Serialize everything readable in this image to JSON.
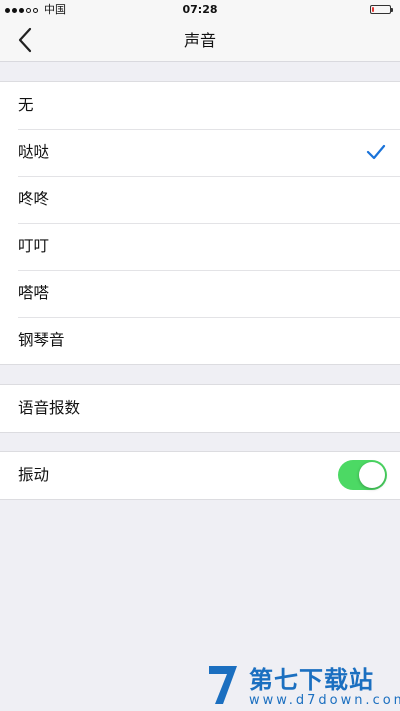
{
  "status_bar": {
    "signal": [
      "full",
      "full",
      "full",
      "empty",
      "empty"
    ],
    "carrier": "中国",
    "time": "07:28",
    "battery_level": 0.08,
    "battery_color": "#e53935"
  },
  "nav": {
    "back_icon": "chevron-left-icon",
    "title": "声音"
  },
  "sound_options": {
    "items": [
      {
        "label": "无",
        "selected": false
      },
      {
        "label": "哒哒",
        "selected": true
      },
      {
        "label": "咚咚",
        "selected": false
      },
      {
        "label": "叮叮",
        "selected": false
      },
      {
        "label": "嗒嗒",
        "selected": false
      },
      {
        "label": "钢琴音",
        "selected": false
      }
    ],
    "check_icon": "checkmark-icon",
    "check_color": "#1a73d9"
  },
  "voice_broadcast": {
    "label": "语音报数"
  },
  "vibration": {
    "label": "振动",
    "enabled": true,
    "on_color": "#4cd964"
  },
  "watermark": {
    "title": "第七下载站",
    "url": "www.d7down.com",
    "color": "#1b6fc0"
  }
}
